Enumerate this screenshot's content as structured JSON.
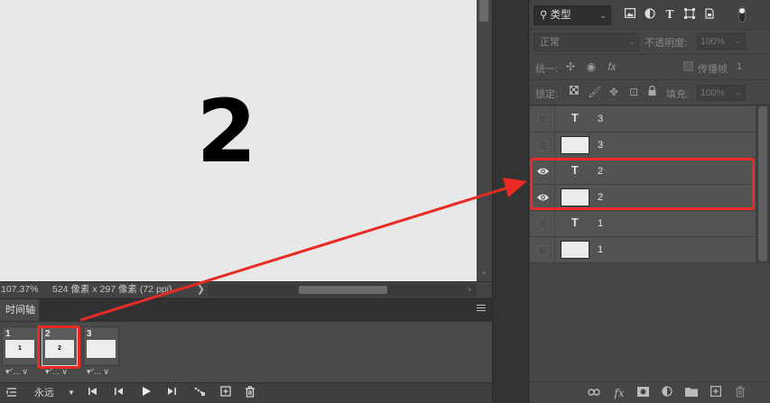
{
  "canvas": {
    "displayed_number": "2"
  },
  "statusbar": {
    "zoom": "107.37%",
    "doc_info": "524 像素 x 297 像素 (72 ppi)",
    "chevron": "❯"
  },
  "timeline": {
    "tab_label": "时间轴",
    "frames": [
      {
        "number": "1",
        "thumb_text": "1",
        "delay": "▾ᐟ... ∨"
      },
      {
        "number": "2",
        "thumb_text": "2",
        "delay": "▾ᐟ... ∨"
      },
      {
        "number": "3",
        "thumb_text": "",
        "delay": "▾ᐟ... ∨"
      }
    ],
    "loop_label": "永远"
  },
  "layers_panel": {
    "filter_label": "类型",
    "blend_mode": "正常",
    "opacity_label": "不透明度:",
    "opacity_value": "100%",
    "unify_label": "统一:",
    "propagate_label": "传播帧",
    "propagate_value": "1",
    "lock_label": "锁定:",
    "fill_label": "填充:",
    "fill_value": "100%",
    "layers": [
      {
        "name": "3",
        "type": "text",
        "visible": false
      },
      {
        "name": "3",
        "type": "pixel",
        "visible": false
      },
      {
        "name": "2",
        "type": "text",
        "visible": true
      },
      {
        "name": "2",
        "type": "pixel",
        "visible": true
      },
      {
        "name": "1",
        "type": "text",
        "visible": false
      },
      {
        "name": "1",
        "type": "pixel",
        "visible": false
      }
    ]
  },
  "colors": {
    "highlight": "#ea2a24",
    "canvas_bg": "#e8e8e8",
    "panel_bg": "#464646"
  }
}
